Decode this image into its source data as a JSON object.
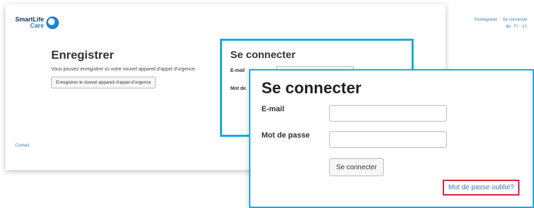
{
  "logo": {
    "line1": "SmartLife",
    "line2": "Care"
  },
  "header": {
    "register_link": "S'enregistrer",
    "login_link": "Se connecter",
    "languages": [
      "de",
      "fr",
      "it"
    ]
  },
  "register": {
    "title": "Enregistrer",
    "description": "Vous pouvez enregistrer ici votre nouvel appareil d'appel d'urgence.",
    "button_label": "Enregistrer le nouvel appareil d'appel d'urgence"
  },
  "footer": {
    "contact": "Contact"
  },
  "login_small": {
    "title": "Se connecter",
    "email_label": "E-mail",
    "password_label": "Mot de"
  },
  "login": {
    "title": "Se connecter",
    "email_label": "E-mail",
    "email_value": "",
    "password_label": "Mot de passe",
    "password_value": "",
    "submit_label": "Se connecter",
    "forgot_link": "Mot de passe oublié?"
  },
  "colors": {
    "highlight_border": "#1da7df",
    "callout_border": "#d7263d",
    "link": "#3a7ab8"
  }
}
